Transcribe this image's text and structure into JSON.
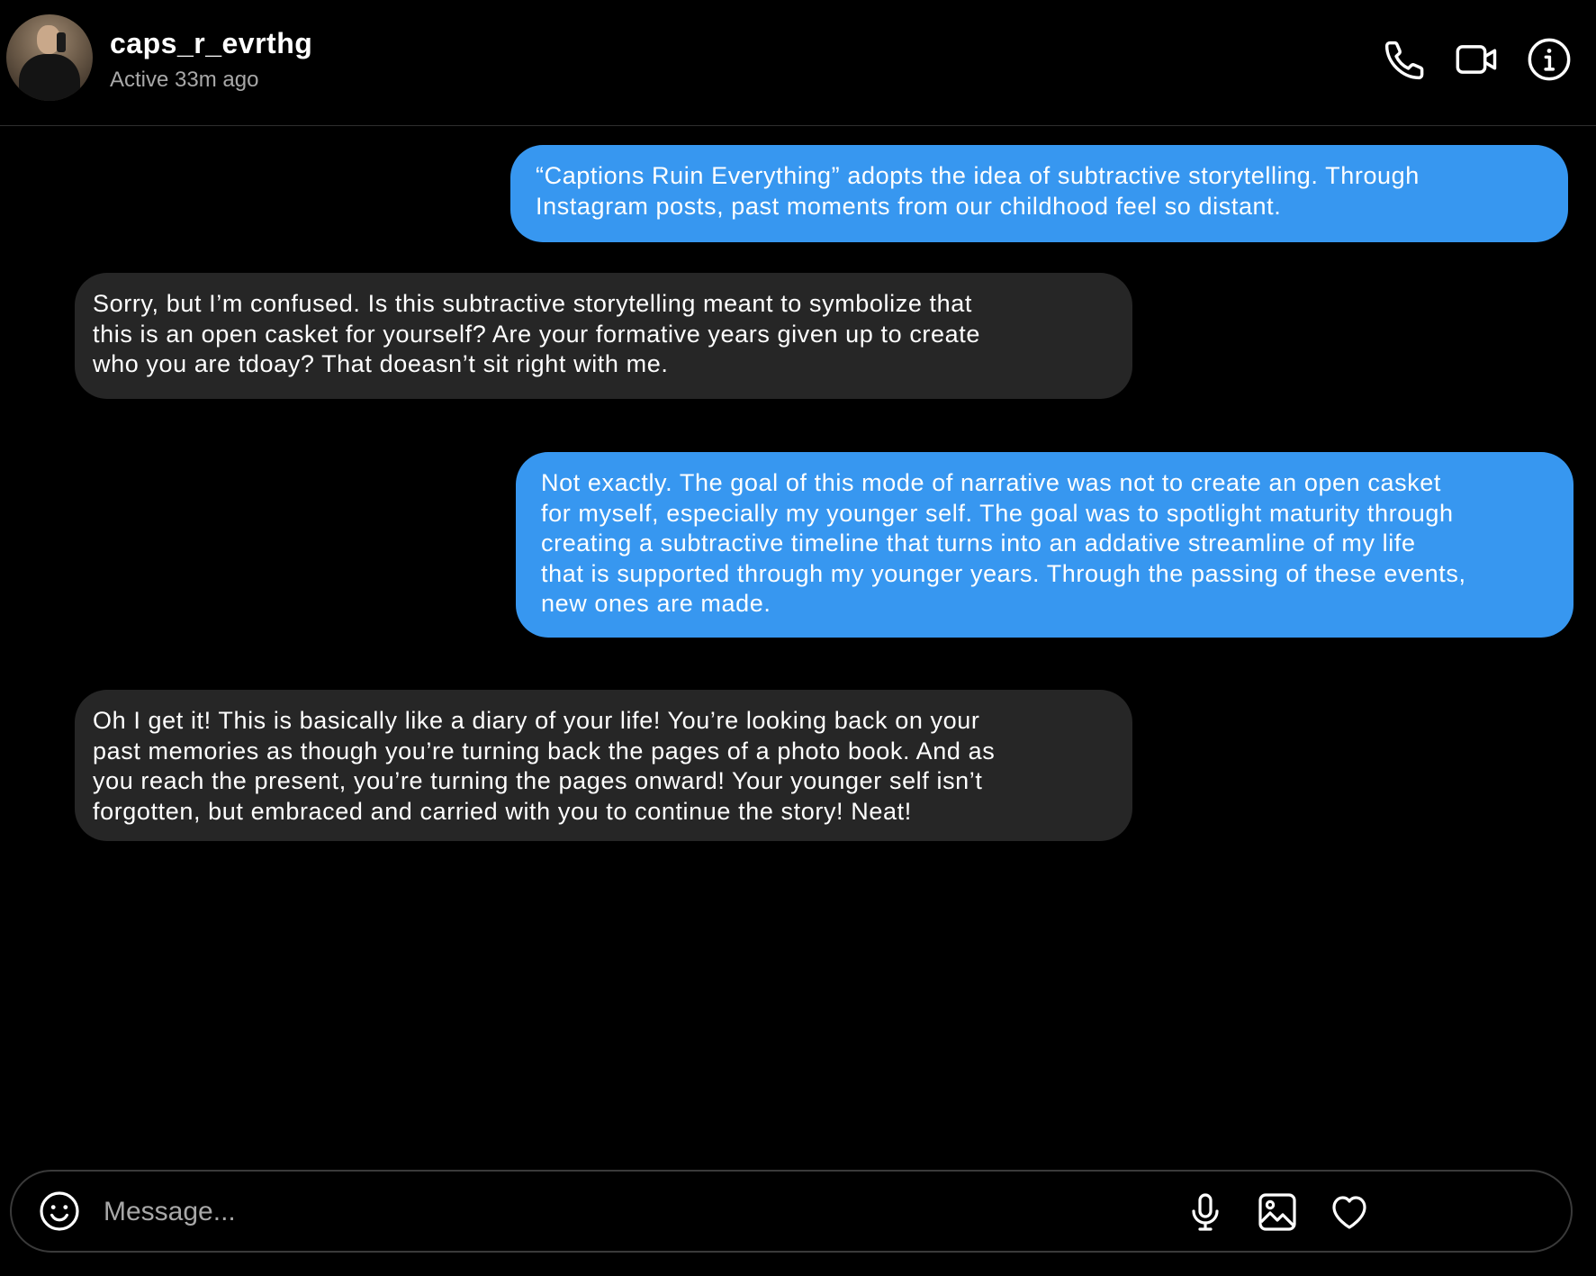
{
  "header": {
    "username": "caps_r_evrthg",
    "status": "Active 33m ago",
    "icons": [
      "phone-icon",
      "video-camera-icon",
      "info-icon"
    ]
  },
  "messages": [
    {
      "direction": "sent",
      "text": "“Captions Ruin Everything” adopts the idea of subtractive storytelling. Through\nInstagram posts, past moments from our childhood feel so distant."
    },
    {
      "direction": "received",
      "text": "Sorry, but I’m confused. Is this subtractive storytelling meant to symbolize that\nthis is an open casket for yourself? Are your formative years given up to create\nwho you are tdoay? That doeasn’t sit right with me."
    },
    {
      "direction": "sent",
      "text": "Not exactly.  The goal of this mode of narrative was not to create an open casket\nfor myself, especially my younger self. The goal was to spotlight maturity through\ncreating a subtractive timeline that turns into an addative streamline of my life\nthat is supported through my younger years. Through the passing of these events,\nnew ones are made."
    },
    {
      "direction": "received",
      "text": "Oh I get it! This is basically like a diary of your life! You’re looking back on your\npast memories as though you’re turning back the pages of a photo book. And as\nyou reach the present, you’re turning the pages onward! Your younger self isn’t\nforgotten, but embraced and carried with you to continue the story! Neat!"
    }
  ],
  "composer": {
    "placeholder": "Message...",
    "value": "",
    "icons": [
      "emoji-icon",
      "microphone-icon",
      "image-icon",
      "heart-icon"
    ]
  },
  "colors": {
    "background": "#000000",
    "sent_bubble": "#3797f0",
    "received_bubble": "#262626",
    "secondary_text": "#a8a8a8"
  }
}
